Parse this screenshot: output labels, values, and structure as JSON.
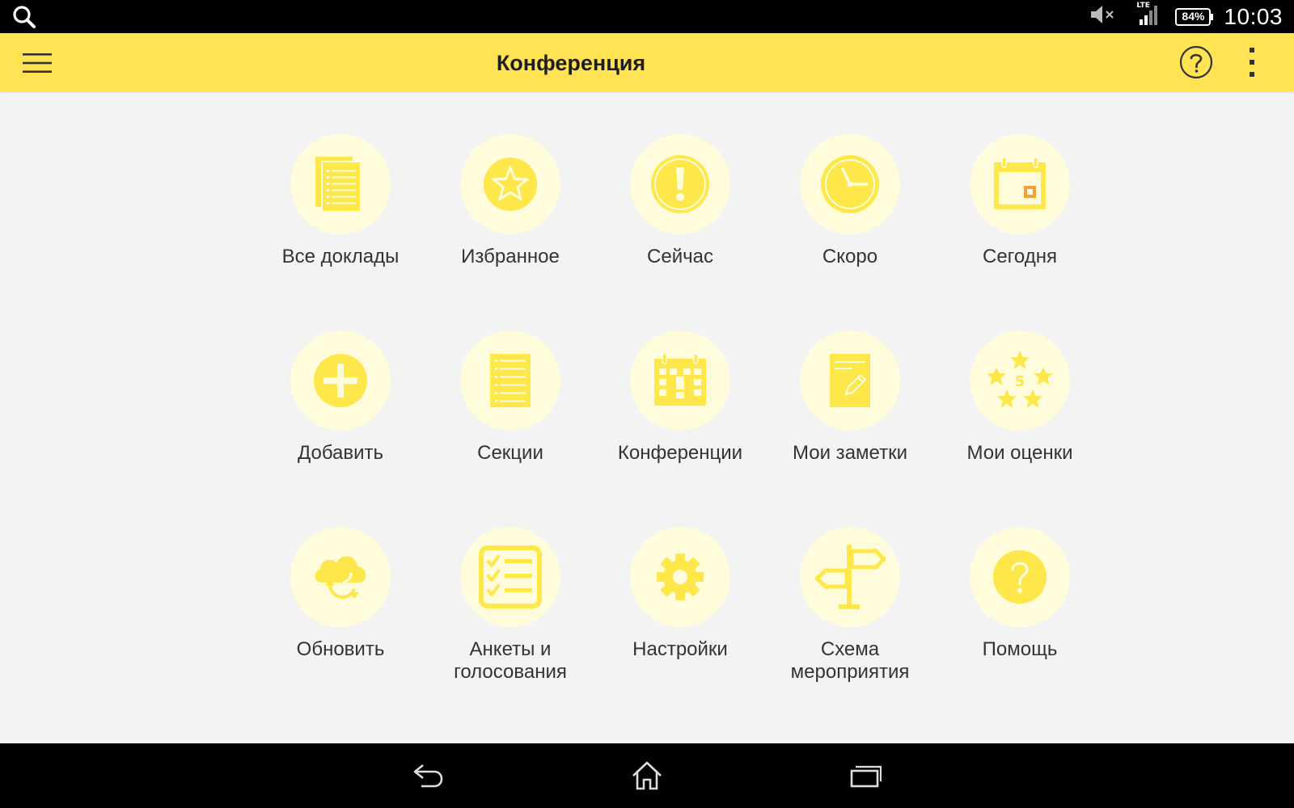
{
  "status_bar": {
    "network": "LTE",
    "battery": "84%",
    "time": "10:03"
  },
  "app_bar": {
    "title": "Конференция"
  },
  "tiles": [
    {
      "label": "Все доклады",
      "icon": "documents-icon"
    },
    {
      "label": "Избранное",
      "icon": "star-icon"
    },
    {
      "label": "Сейчас",
      "icon": "exclamation-icon"
    },
    {
      "label": "Скоро",
      "icon": "clock-icon"
    },
    {
      "label": "Сегодня",
      "icon": "calendar-today-icon"
    },
    {
      "label": "Добавить",
      "icon": "plus-icon"
    },
    {
      "label": "Секции",
      "icon": "list-icon"
    },
    {
      "label": "Конференции",
      "icon": "calendar-event-icon"
    },
    {
      "label": "Мои заметки",
      "icon": "notepad-icon"
    },
    {
      "label": "Мои оценки",
      "icon": "rating-stars-icon",
      "badge": "5"
    },
    {
      "label": "Обновить",
      "icon": "cloud-sync-icon"
    },
    {
      "label": "Анкеты и\nголосования",
      "icon": "checklist-icon"
    },
    {
      "label": "Настройки",
      "icon": "gear-icon"
    },
    {
      "label": "Схема\nмероприятия",
      "icon": "signpost-icon"
    },
    {
      "label": "Помощь",
      "icon": "help-icon"
    }
  ],
  "colors": {
    "accent": "#ffe352",
    "icon": "#fde74a",
    "icon_bg": "#fefcda",
    "calendar_mark": "#f2a03a"
  }
}
